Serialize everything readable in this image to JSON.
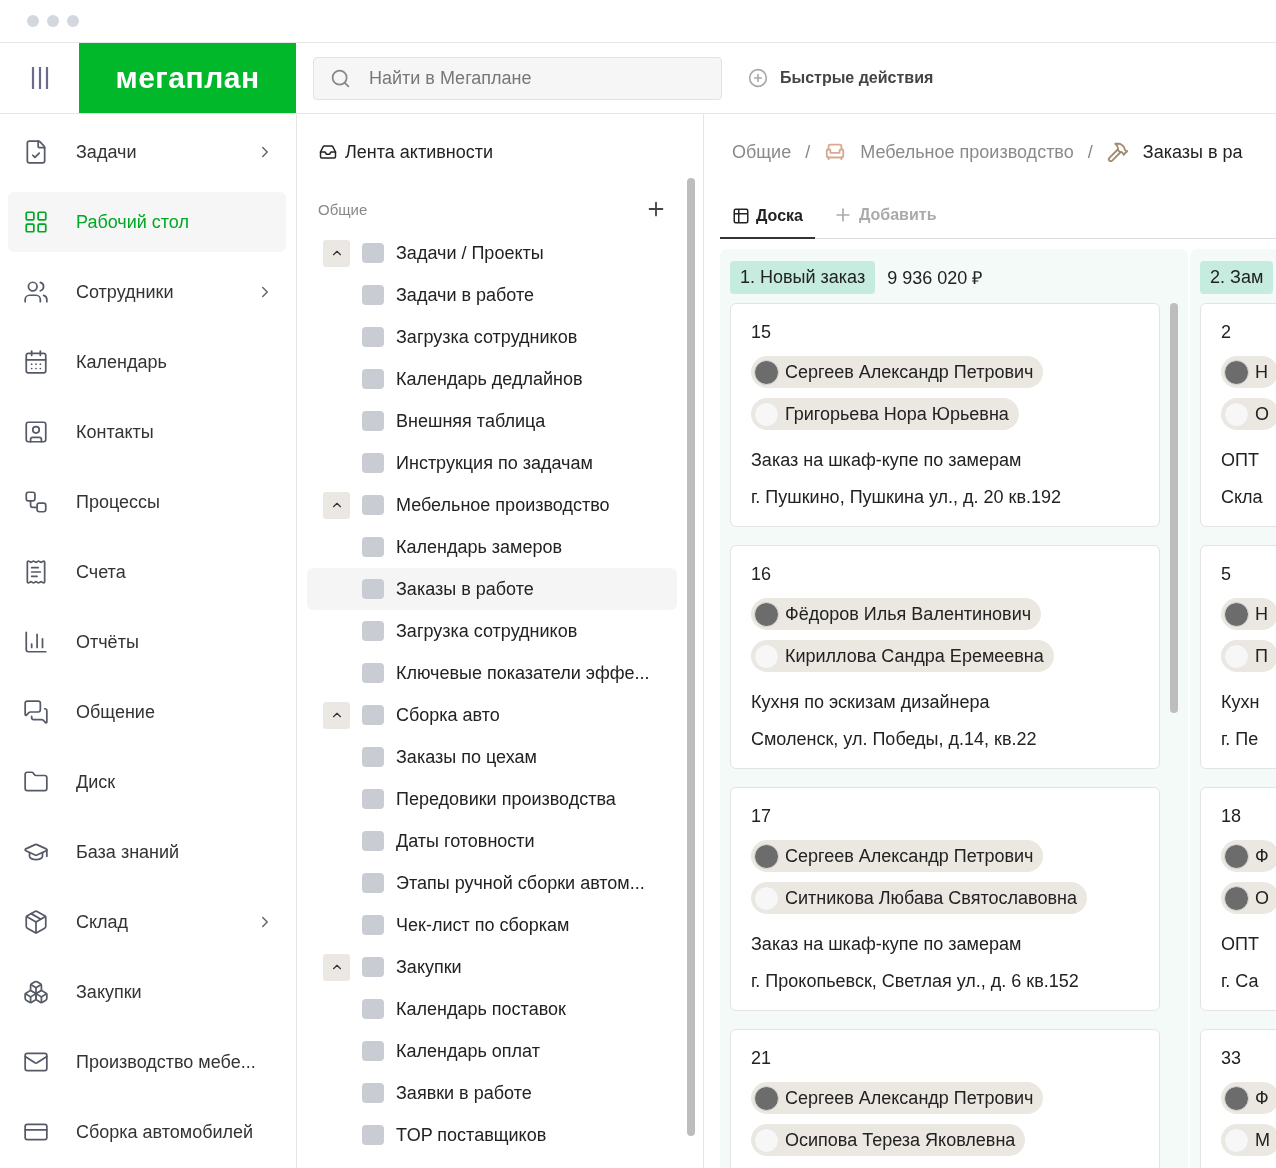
{
  "header": {
    "logo": "мегаплан",
    "search": {
      "placeholder": "Найти в Мегаплане"
    },
    "quick_actions": "Быстрые действия"
  },
  "sidebar": {
    "items": [
      {
        "label": "Задачи",
        "selected": false,
        "has_submenu": true
      },
      {
        "label": "Рабочий стол",
        "selected": true,
        "has_submenu": false
      },
      {
        "label": "Сотрудники",
        "selected": false,
        "has_submenu": true
      },
      {
        "label": "Календарь",
        "selected": false,
        "has_submenu": false
      },
      {
        "label": "Контакты",
        "selected": false,
        "has_submenu": false
      },
      {
        "label": "Процессы",
        "selected": false,
        "has_submenu": false
      },
      {
        "label": "Счета",
        "selected": false,
        "has_submenu": false
      },
      {
        "label": "Отчёты",
        "selected": false,
        "has_submenu": false
      },
      {
        "label": "Общение",
        "selected": false,
        "has_submenu": false
      },
      {
        "label": "Диск",
        "selected": false,
        "has_submenu": false
      },
      {
        "label": "База знаний",
        "selected": false,
        "has_submenu": false
      },
      {
        "label": "Склад",
        "selected": false,
        "has_submenu": true
      },
      {
        "label": "Закупки",
        "selected": false,
        "has_submenu": false
      },
      {
        "label": "Производство мебе...",
        "selected": false,
        "has_submenu": false
      },
      {
        "label": "Сборка автомобилей",
        "selected": false,
        "has_submenu": false
      }
    ]
  },
  "tree": {
    "activity_feed": "Лента активности",
    "section": "Общие",
    "groups": [
      {
        "label": "Задачи / Проекты",
        "expanded": true,
        "children": [
          {
            "label": "Задачи в работе",
            "selected": false
          },
          {
            "label": "Загрузка сотрудников",
            "selected": false
          },
          {
            "label": "Календарь дедлайнов",
            "selected": false
          },
          {
            "label": "Внешняя таблица",
            "selected": false
          },
          {
            "label": "Инструкция по задачам",
            "selected": false
          }
        ]
      },
      {
        "label": "Мебельное производство",
        "expanded": true,
        "children": [
          {
            "label": "Календарь замеров",
            "selected": false
          },
          {
            "label": "Заказы в работе",
            "selected": true
          },
          {
            "label": "Загрузка сотрудников",
            "selected": false
          },
          {
            "label": "Ключевые показатели эффе...",
            "selected": false
          }
        ]
      },
      {
        "label": "Сборка авто",
        "expanded": true,
        "children": [
          {
            "label": "Заказы по цехам",
            "selected": false
          },
          {
            "label": "Передовики производства",
            "selected": false
          },
          {
            "label": "Даты готовности",
            "selected": false
          },
          {
            "label": "Этапы ручной сборки автом...",
            "selected": false
          },
          {
            "label": "Чек-лист по сборкам",
            "selected": false
          }
        ]
      },
      {
        "label": "Закупки",
        "expanded": true,
        "children": [
          {
            "label": "Календарь поставок",
            "selected": false
          },
          {
            "label": "Календарь оплат",
            "selected": false
          },
          {
            "label": "Заявки в работе",
            "selected": false
          },
          {
            "label": "TOP поставщиков",
            "selected": false
          }
        ]
      }
    ]
  },
  "breadcrumbs": [
    {
      "label": "Общие"
    },
    {
      "separator": "/",
      "label": "Мебельное производство"
    },
    {
      "separator": "/",
      "label": "Заказы в ра"
    }
  ],
  "tabs": [
    {
      "label": "Доска",
      "selected": true
    },
    {
      "label": "Добавить",
      "selected": false
    }
  ],
  "board": {
    "columns": [
      {
        "title": "1. Новый заказ",
        "total": "9 936 020 ₽",
        "cards": [
          {
            "number": "15",
            "people": [
              {
                "name": "Сергеев Александр Петрович",
                "photo": true
              },
              {
                "name": "Григорьева Нора Юрьевна",
                "photo": false
              }
            ],
            "lines": [
              "Заказ на шкаф-купе по замерам",
              "г. Пушкино, Пушкина ул., д. 20 кв.192"
            ]
          },
          {
            "number": "16",
            "people": [
              {
                "name": "Фёдоров Илья Валентинович",
                "photo": true
              },
              {
                "name": "Кириллова Сандра Еремеевна",
                "photo": false
              }
            ],
            "lines": [
              "Кухня по эскизам дизайнера",
              "Смоленск, ул. Победы, д.14, кв.22"
            ]
          },
          {
            "number": "17",
            "people": [
              {
                "name": "Сергеев Александр Петрович",
                "photo": true
              },
              {
                "name": "Ситникова Любава Святославовна",
                "photo": false
              }
            ],
            "lines": [
              "Заказ на шкаф-купе по замерам",
              "г. Прокопьевск, Светлая ул., д. 6 кв.152"
            ]
          },
          {
            "number": "21",
            "people": [
              {
                "name": "Сергеев Александр Петрович",
                "photo": true
              },
              {
                "name": "Осипова Тереза Яковлевна",
                "photo": false
              }
            ]
          }
        ]
      },
      {
        "title": "2. Зам",
        "cards": [
          {
            "number": "2",
            "people": [
              {
                "name": "Н",
                "photo": true
              },
              {
                "name": "О",
                "photo": false
              }
            ],
            "lines": [
              "ОПТ",
              "Скла"
            ]
          },
          {
            "number": "5",
            "people": [
              {
                "name": "Н",
                "photo": true
              },
              {
                "name": "П",
                "photo": false
              }
            ],
            "lines": [
              "Кухн",
              "г. Пе"
            ]
          },
          {
            "number": "18",
            "people": [
              {
                "name": "Ф",
                "photo": true
              },
              {
                "name": "О",
                "photo": true
              }
            ],
            "lines": [
              "ОПТ",
              "г. Са"
            ]
          },
          {
            "number": "33",
            "people": [
              {
                "name": "Ф",
                "photo": true
              },
              {
                "name": "М",
                "photo": false
              }
            ]
          }
        ]
      }
    ]
  }
}
